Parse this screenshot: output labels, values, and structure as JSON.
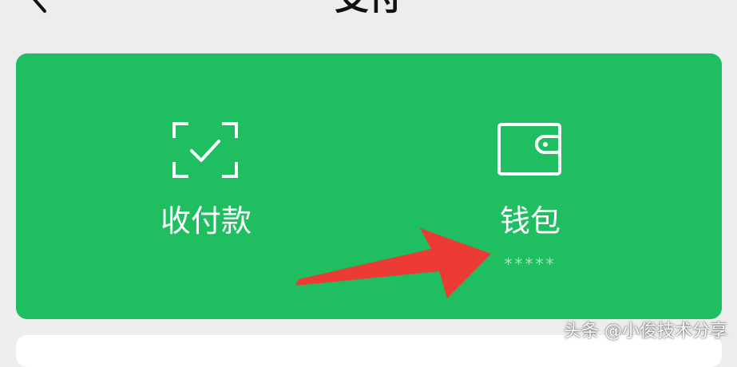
{
  "header": {
    "title": "支付",
    "back_icon": "chevron-left-icon"
  },
  "pay_card": {
    "background": "#1ebe61",
    "items": [
      {
        "label": "收付款",
        "icon": "scan-check-icon"
      },
      {
        "label": "钱包",
        "sublabel": "*****",
        "icon": "wallet-icon"
      }
    ]
  },
  "annotation": {
    "arrow_color": "#ec3a34"
  },
  "watermark": {
    "text": "头条 @小俊技术分享"
  }
}
